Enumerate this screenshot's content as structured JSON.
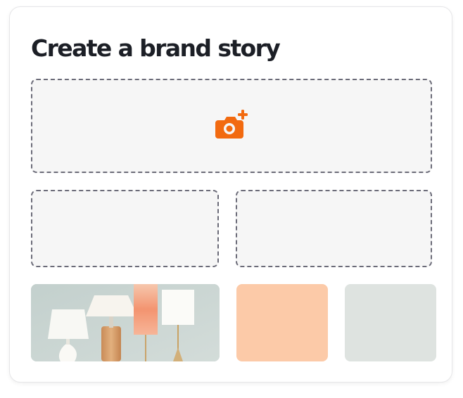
{
  "card": {
    "title": "Create a brand story"
  },
  "upload": {
    "main_icon": "camera-plus-icon",
    "accent_color": "#f26a10"
  },
  "swatches": {
    "photo_subject": "table lamps",
    "peach_color": "#fccaa8",
    "grey_color": "#dee3e0"
  }
}
